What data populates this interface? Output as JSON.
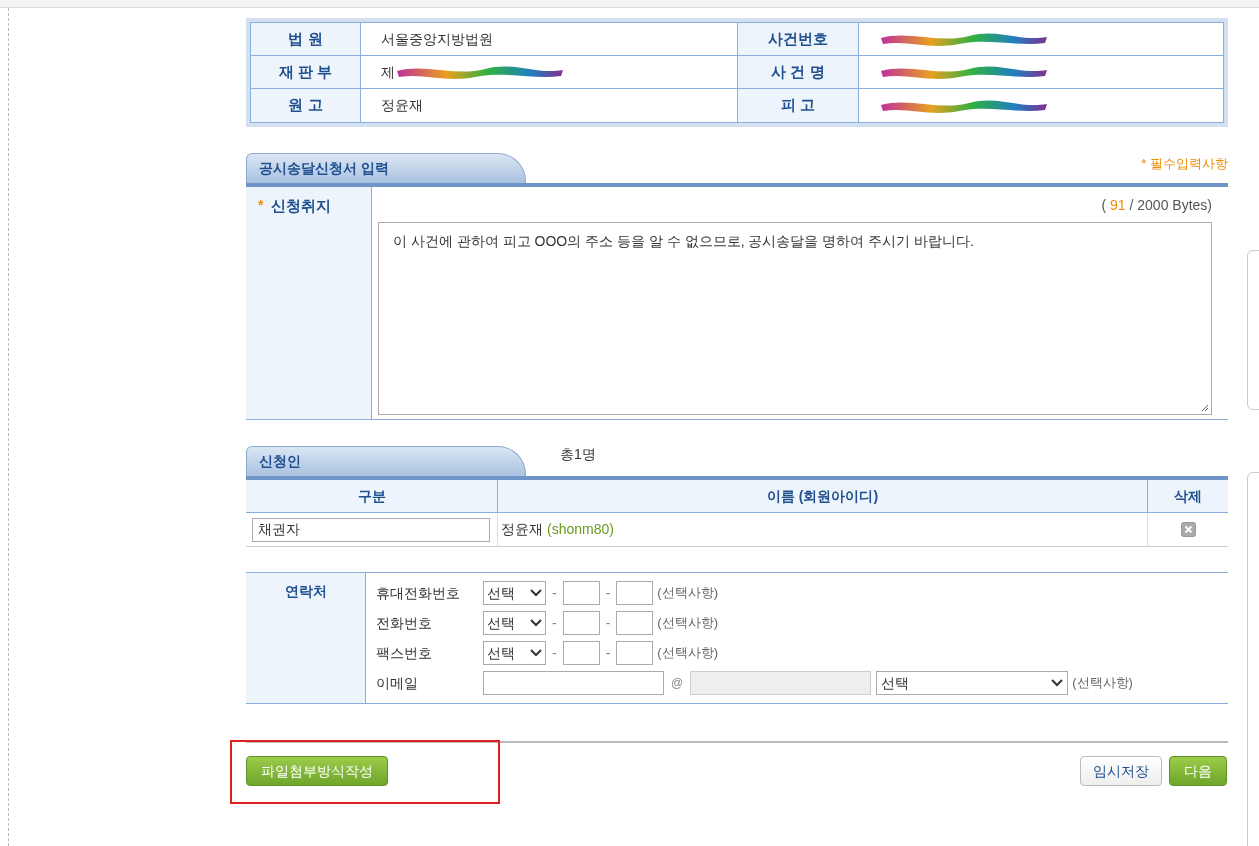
{
  "case_info": [
    {
      "label": "법 원",
      "value": "서울중앙지방법원",
      "redacted": false
    },
    {
      "label": "사건번호",
      "redacted": true
    },
    {
      "label": "재 판 부",
      "value": "제",
      "redacted": true
    },
    {
      "label": "사 건 명",
      "redacted": true
    },
    {
      "label": "원 고",
      "value": "정윤재",
      "redacted": false
    },
    {
      "label": "피 고",
      "redacted": true
    }
  ],
  "request_section": {
    "tab": "공시송달신청서 입력",
    "required_note": "* 필수입력사항",
    "field_label": "신청취지",
    "required_mark": "*",
    "counter_open": "(",
    "counter_count": "91",
    "counter_rest": "/ 2000 Bytes)",
    "text": "이 사건에 관하여 피고 OOO의 주소 등을 알 수 없으므로, 공시송달을 명하여 주시기 바랍니다."
  },
  "applicant_section": {
    "tab": "신청인",
    "total": "총1명",
    "columns": [
      "구분",
      "이름 (회원아이디)",
      "삭제"
    ],
    "rows": [
      {
        "type": "채권자",
        "name": "정윤재",
        "user_id": "(shonm80)"
      }
    ]
  },
  "contact_section": {
    "label": "연락처",
    "rows": [
      {
        "kind": "phone",
        "label": "휴대전화번호",
        "select": "선택",
        "dash": "-",
        "note": "(선택사항)"
      },
      {
        "kind": "phone",
        "label": "전화번호",
        "select": "선택",
        "dash": "-",
        "note": "(선택사항)"
      },
      {
        "kind": "phone",
        "label": "팩스번호",
        "select": "선택",
        "dash": "-",
        "note": "(선택사항)"
      },
      {
        "kind": "email",
        "label": "이메일",
        "at": "@",
        "select": "선택",
        "note": "(선택사항)"
      }
    ]
  },
  "buttons": {
    "attach": "파일첨부방식작성",
    "save": "임시저장",
    "next": "다음"
  }
}
